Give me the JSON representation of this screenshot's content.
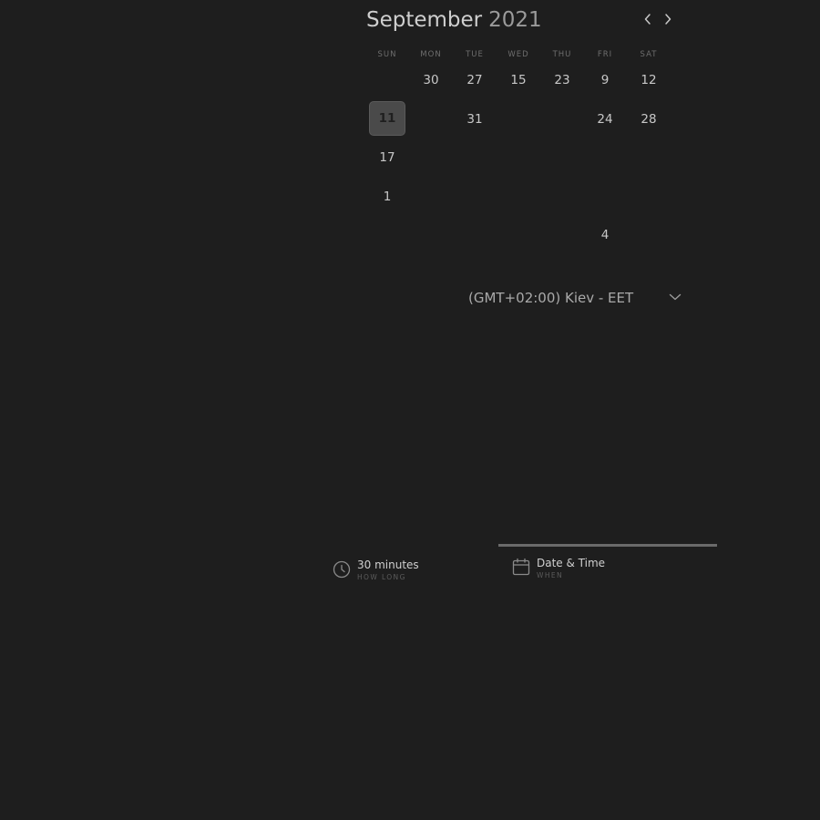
{
  "calendar": {
    "month": "September",
    "year": "2021",
    "prev_icon": "chevron-left-icon",
    "next_icon": "chevron-right-icon",
    "weekdays": [
      "SUN",
      "MON",
      "TUE",
      "WED",
      "THU",
      "FRI",
      "SAT"
    ],
    "days": {
      "r1_mon": "30",
      "r1_tue": "27",
      "r1_wed": "15",
      "r1_thu": "23",
      "r1_fri": "9",
      "r1_sat": "12",
      "r2_sun": "11",
      "r2_tue": "31",
      "r2_fri": "24",
      "r2_sat": "28",
      "r3_sun": "17",
      "r4_sun": "1",
      "r5_fri": "4"
    },
    "selected_day": "11"
  },
  "timezone": {
    "label": "(GMT+02:00) Kiev - EET",
    "icon": "chevron-down-icon"
  },
  "steps": {
    "duration": {
      "title": "30 minutes",
      "subtitle": "HOW LONG",
      "icon": "clock-icon"
    },
    "datetime": {
      "title": "Date & Time",
      "subtitle": "WHEN",
      "icon": "calendar-icon",
      "active": true
    }
  },
  "colors": {
    "background": "#1e1e1e",
    "text": "#c8c8c8",
    "muted": "#6e6e6e",
    "selected_bg": "#4a4a4a",
    "progress": "#6a6a6a"
  }
}
